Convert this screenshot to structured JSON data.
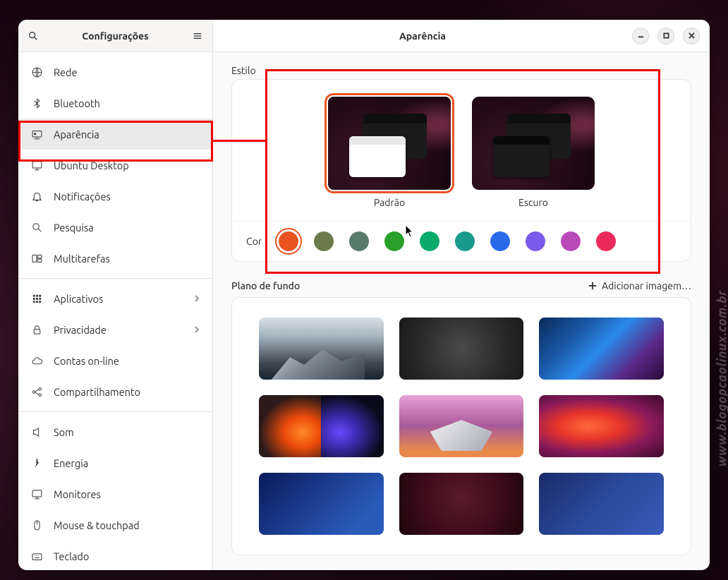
{
  "titlebar": {
    "left_title": "Configurações",
    "right_title": "Aparência"
  },
  "sidebar": {
    "items": [
      {
        "label": "Rede",
        "icon": "network"
      },
      {
        "label": "Bluetooth",
        "icon": "bluetooth"
      },
      {
        "label": "Aparência",
        "icon": "appearance",
        "active": true
      },
      {
        "label": "Ubuntu Desktop",
        "icon": "desktop"
      },
      {
        "label": "Notificações",
        "icon": "bell"
      },
      {
        "label": "Pesquisa",
        "icon": "search"
      },
      {
        "label": "Multitarefas",
        "icon": "multitasking"
      },
      {
        "label": "Aplicativos",
        "icon": "apps",
        "chevron": true
      },
      {
        "label": "Privacidade",
        "icon": "lock",
        "chevron": true
      },
      {
        "label": "Contas on-line",
        "icon": "cloud"
      },
      {
        "label": "Compartilhamento",
        "icon": "share"
      },
      {
        "label": "Som",
        "icon": "sound"
      },
      {
        "label": "Energia",
        "icon": "power"
      },
      {
        "label": "Monitores",
        "icon": "display"
      },
      {
        "label": "Mouse & touchpad",
        "icon": "mouse"
      },
      {
        "label": "Teclado",
        "icon": "keyboard"
      }
    ]
  },
  "style_section": {
    "label": "Estilo",
    "themes": [
      {
        "label": "Padrão",
        "selected": true
      },
      {
        "label": "Escuro",
        "selected": false
      }
    ],
    "color_label": "Cor",
    "colors": [
      {
        "hex": "#e95420",
        "selected": true
      },
      {
        "hex": "#6a7a4a"
      },
      {
        "hex": "#5a7a6a"
      },
      {
        "hex": "#2aa02a"
      },
      {
        "hex": "#0aaa6a"
      },
      {
        "hex": "#1a9a8a"
      },
      {
        "hex": "#2a6aea"
      },
      {
        "hex": "#7a5aea"
      },
      {
        "hex": "#ba4aba"
      },
      {
        "hex": "#ea2a5a"
      }
    ]
  },
  "background_section": {
    "label": "Plano de fundo",
    "add_label": "Adicionar imagem…"
  },
  "watermark": "www.blogopcaolinux.com.br"
}
